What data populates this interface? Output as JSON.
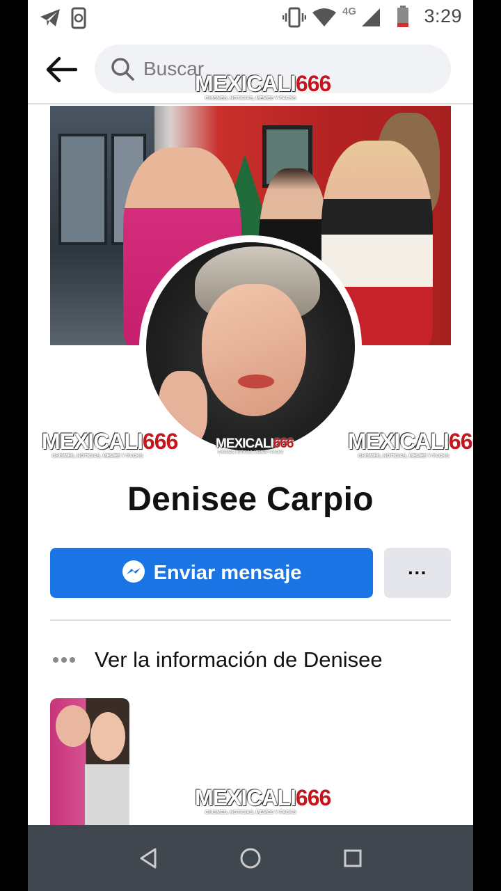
{
  "status_bar": {
    "time": "3:29",
    "network": "4G",
    "icons": [
      "telegram-icon",
      "phone-sync-icon",
      "vibrate-icon",
      "wifi-icon",
      "signal-icon",
      "battery-icon"
    ]
  },
  "search": {
    "placeholder": "Buscar"
  },
  "profile": {
    "name": "Denisee Carpio",
    "message_button": "Enviar mensaje",
    "more_button": "···",
    "info_link": "Ver la información de Denisee"
  },
  "watermark": {
    "brand_text": "MEXICALI",
    "brand_number": "666",
    "tagline": "CHISMES, NOTICIAS, MEMES Y PACKS"
  },
  "colors": {
    "accent": "#1b74e4",
    "secondary_button": "#e4e6eb",
    "nav_bar": "#41474e",
    "battery_low": "#d32f2f"
  },
  "nav": {
    "icons": [
      "back-nav-icon",
      "home-nav-icon",
      "recents-nav-icon"
    ]
  }
}
